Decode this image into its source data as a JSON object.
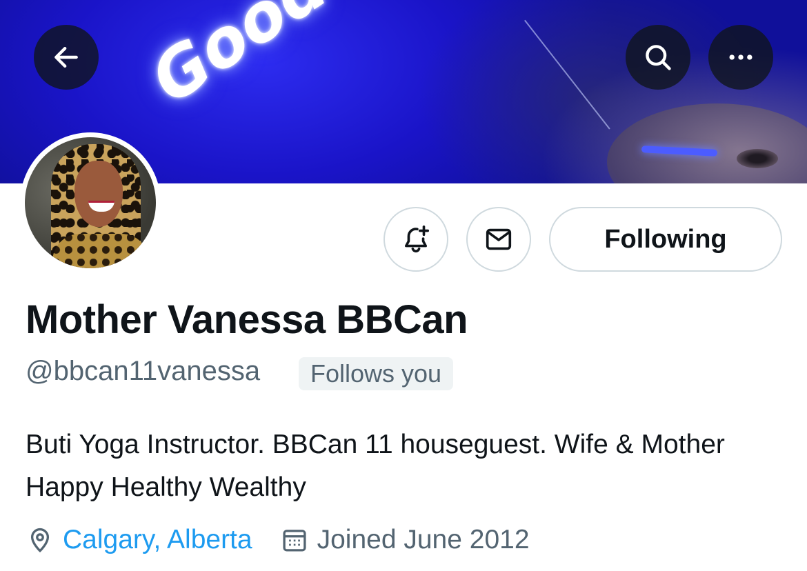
{
  "banner": {
    "neon_text": "Good Vi"
  },
  "header": {
    "back_icon": "arrow-left-icon",
    "search_icon": "search-icon",
    "more_icon": "more-horizontal-icon"
  },
  "actions": {
    "notify_icon": "bell-plus-icon",
    "message_icon": "envelope-icon",
    "following_label": "Following"
  },
  "profile": {
    "display_name": "Mother Vanessa BBCan",
    "handle": "@bbcan11vanessa",
    "follows_you": "Follows you",
    "bio": "Buti Yoga Instructor. BBCan 11 houseguest. Wife & Mother Happy Healthy Wealthy",
    "location": "Calgary, Alberta",
    "joined": "Joined June 2012"
  },
  "colors": {
    "link": "#1d9bf0",
    "secondary_text": "#536471",
    "border": "#cfd9de",
    "badge_bg": "#eff3f4"
  }
}
